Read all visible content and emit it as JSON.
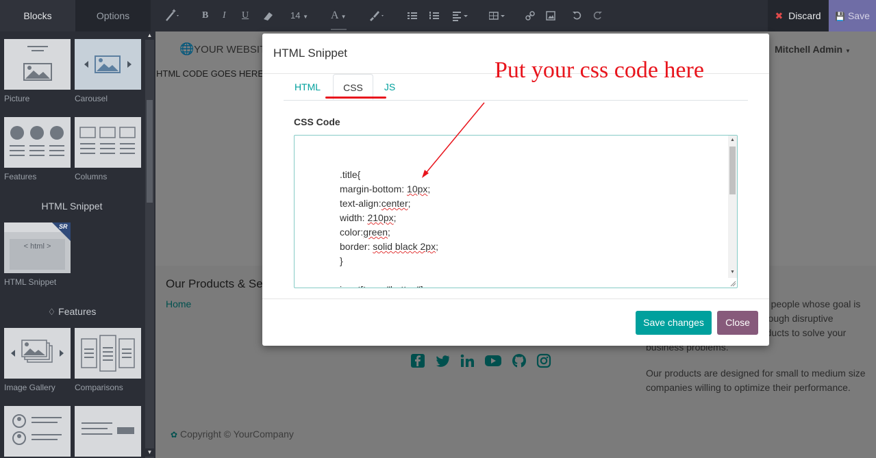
{
  "sidebar": {
    "tabs": [
      "Blocks",
      "Options"
    ],
    "blocks": {
      "picture": "Picture",
      "carousel": "Carousel",
      "features": "Features",
      "columns": "Columns",
      "html_snippet": "HTML Snippet",
      "image_gallery": "Image Gallery",
      "comparisons": "Comparisons"
    },
    "html_thumb_text": "< html >",
    "sr_badge": "SR",
    "sections": {
      "html_snippet": "HTML Snippet",
      "features": "Features"
    }
  },
  "toolbar": {
    "font_bold": "B",
    "font_italic": "I",
    "font_underline": "U",
    "font_size": "14",
    "font_color": "A",
    "discard_label": "Discard",
    "save_label": "Save"
  },
  "page": {
    "logo_text": "YOUR WEBSITE",
    "user_name": "Mitchell Admin",
    "html_placeholder": "HTML CODE GOES HERE",
    "products_heading": "Our Products & Services",
    "home_link": "Home",
    "about_text_1": "We are a team of passionate people whose goal is to improve everyone's life through disruptive products. We build great products to solve your business problems.",
    "about_text_2": "Our products are designed for small to medium size companies willing to optimize their performance.",
    "copyright": "Copyright © YourCompany"
  },
  "modal": {
    "title": "HTML Snippet",
    "tabs": [
      "HTML",
      "CSS",
      "JS"
    ],
    "active_tab": "CSS",
    "code_label": "CSS Code",
    "css_lines": [
      ".title{",
      "margin-bottom: 10px;",
      "text-align:center;",
      "width: 210px;",
      "color:green;",
      "border: solid black 2px;",
      "}",
      "",
      "input[type=\"button\"]"
    ],
    "save_label": "Save changes",
    "close_label": "Close"
  },
  "annotation": {
    "text": "Put your css code here"
  },
  "colors": {
    "primary": "#00a09d",
    "secondary": "#875a7b",
    "annotation": "#e8141c",
    "save_btn": "#6f6da6"
  }
}
